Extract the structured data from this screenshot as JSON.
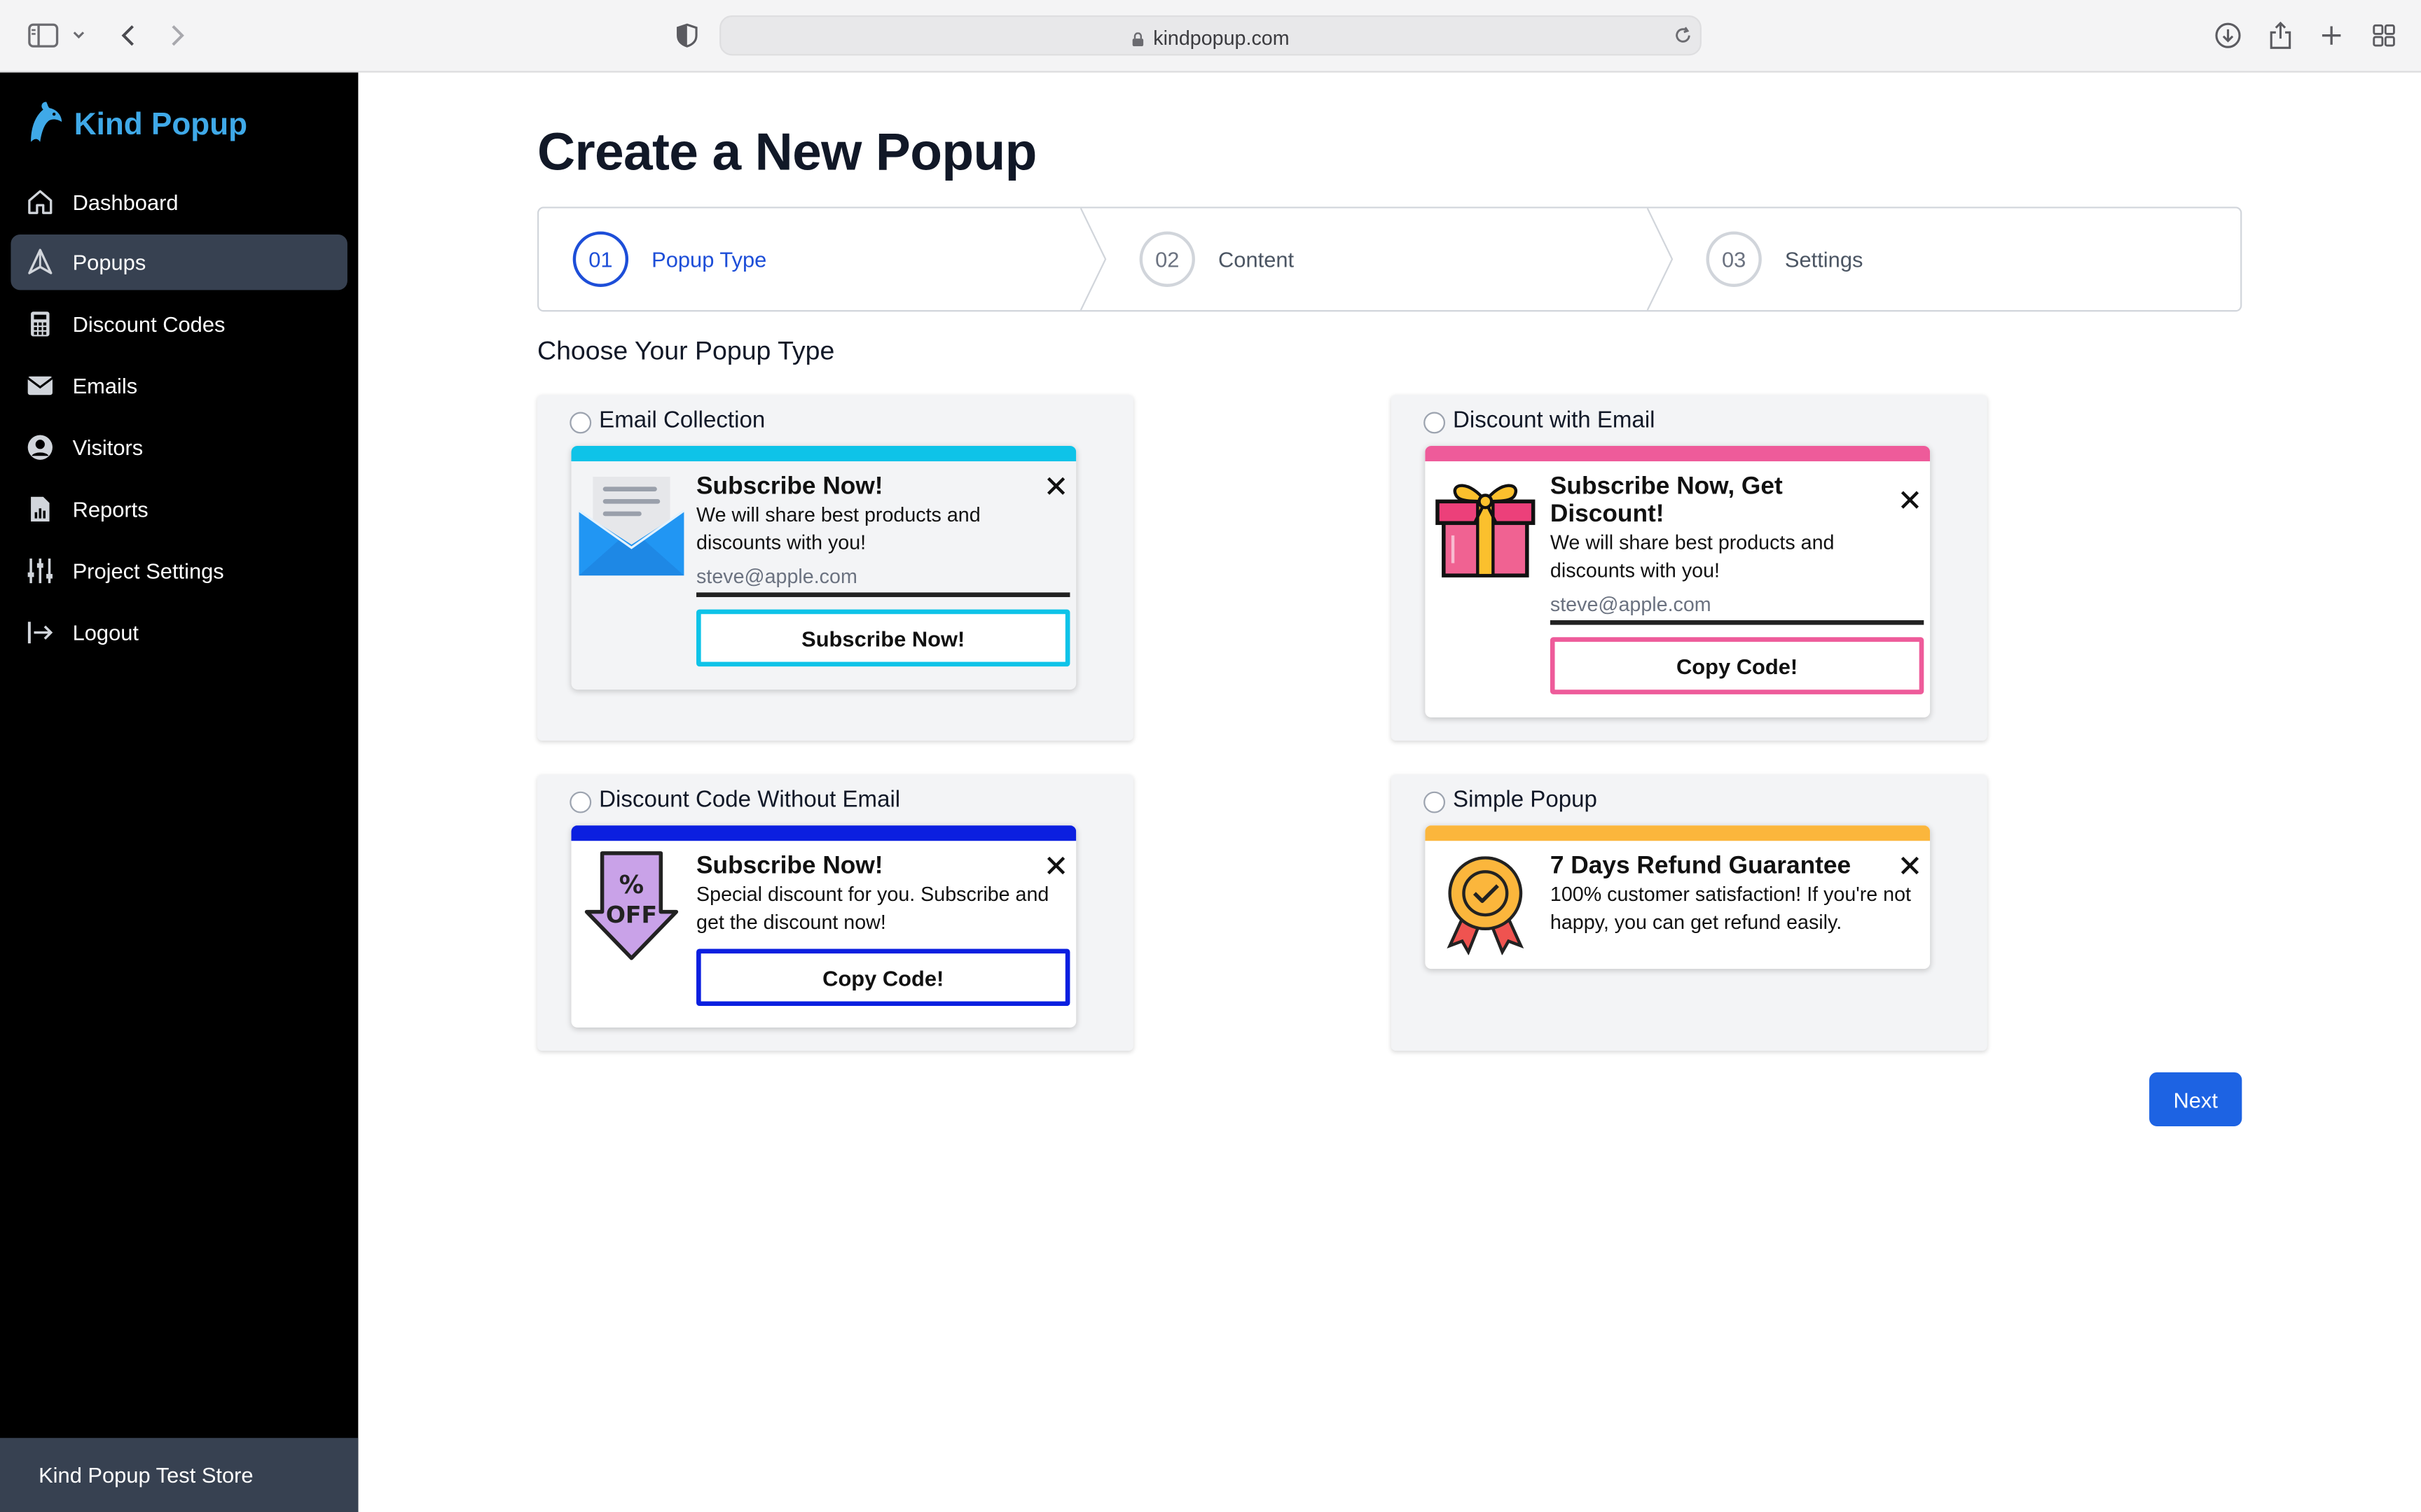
{
  "browser": {
    "url": "kindpopup.com"
  },
  "sidebar": {
    "brand": "Kind Popup",
    "items": [
      {
        "label": "Dashboard",
        "icon": "home-icon"
      },
      {
        "label": "Popups",
        "icon": "send-icon"
      },
      {
        "label": "Discount Codes",
        "icon": "calculator-icon"
      },
      {
        "label": "Emails",
        "icon": "envelope-icon"
      },
      {
        "label": "Visitors",
        "icon": "user-circle-icon"
      },
      {
        "label": "Reports",
        "icon": "report-icon"
      },
      {
        "label": "Project Settings",
        "icon": "sliders-icon"
      },
      {
        "label": "Logout",
        "icon": "logout-icon"
      }
    ],
    "active_item": "Popups",
    "store": "Kind Popup Test Store"
  },
  "main": {
    "title": "Create a New Popup",
    "steps": [
      {
        "number": "01",
        "label": "Popup Type"
      },
      {
        "number": "02",
        "label": "Content"
      },
      {
        "number": "03",
        "label": "Settings"
      }
    ],
    "active_step": "01",
    "section_title": "Choose Your Popup Type",
    "popup_types": [
      {
        "label": "Email Collection",
        "accent": "#0ec3e8",
        "title": "Subscribe Now!",
        "text": "We will share best products and discounts with you!",
        "email_placeholder": "steve@apple.com",
        "button": "Subscribe Now!"
      },
      {
        "label": "Discount with Email",
        "accent": "#ee5b9a",
        "title": "Subscribe Now, Get Discount!",
        "text": "We will share best products and discounts with you!",
        "email_placeholder": "steve@apple.com",
        "button": "Copy Code!"
      },
      {
        "label": "Discount Code Without Email",
        "accent": "#0b1fe0",
        "title": "Subscribe Now!",
        "text": "Special discount for you. Subscribe and get the discount now!",
        "button": "Copy Code!"
      },
      {
        "label": "Simple Popup",
        "accent": "#fbb63c",
        "title": "7 Days Refund Guarantee",
        "text": "100% customer satisfaction! If you're not happy, you can get refund easily."
      }
    ],
    "next_button": "Next"
  },
  "colors": {
    "primary": "#1d63e3",
    "sidebar_bg": "#000000",
    "active_nav": "#374151"
  }
}
